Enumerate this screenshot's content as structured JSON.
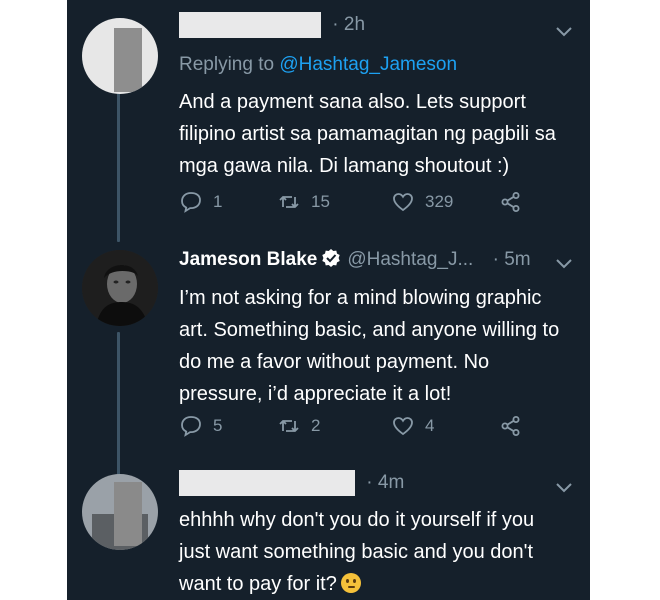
{
  "colors": {
    "background": "#15202b",
    "text": "#ffffff",
    "muted": "#8899a6",
    "link": "#1da1f2",
    "thread_line": "#3d5466"
  },
  "tweets": [
    {
      "author_redacted": true,
      "time": "· 2h",
      "reply_label": "Replying to ",
      "reply_handle": "@Hashtag_Jameson",
      "lines": [
        "And a payment sana also. Lets support",
        "filipino artist sa pamamagitan ng pagbili sa",
        "mga gawa nila. Di lamang shoutout :)"
      ],
      "replies": "1",
      "retweets": "15",
      "likes": "329"
    },
    {
      "author": "Jameson Blake",
      "verified": true,
      "handle": "@Hashtag_J...",
      "time": "· 5m",
      "lines": [
        "I’m not asking for a mind blowing graphic",
        "art. Something basic, and anyone willing to",
        "do me a favor without payment. No",
        "pressure, i’d appreciate it a lot!"
      ],
      "replies": "5",
      "retweets": "2",
      "likes": "4"
    },
    {
      "author_redacted": true,
      "time": "· 4m",
      "lines": [
        "ehhhh why don't you do it yourself if you",
        "just want something basic and you don't",
        "want to pay for it?"
      ],
      "emoji": "confused-face-emoji"
    }
  ]
}
